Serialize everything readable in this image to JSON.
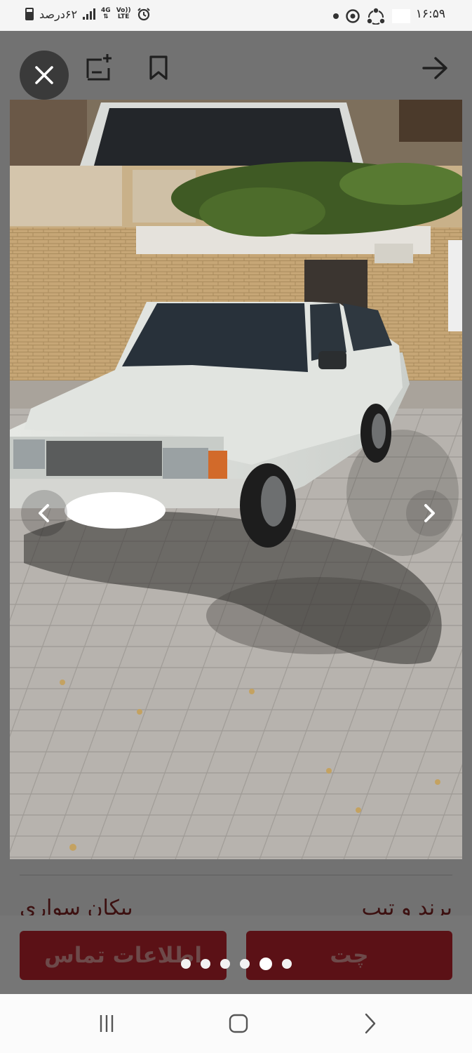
{
  "status_bar": {
    "time": "۱۶:۵۹",
    "battery_text": "۶۲درصد",
    "network_top": "4G",
    "volte_top": "Vo))",
    "volte_bottom": "LTE"
  },
  "toolbar": {
    "close_icon": "close-icon",
    "add_note_icon": "add-note-icon",
    "bookmark_icon": "bookmark-icon",
    "back_icon": "arrow-right-icon"
  },
  "gallery": {
    "image_alt": "",
    "dots_count": 6,
    "active_index": 4
  },
  "listing": {
    "title_right": "برند و تیپ",
    "title_left": "پیکان سواری"
  },
  "actions": {
    "contact_label": "اطلاعات تماس",
    "chat_label": "چت"
  },
  "colors": {
    "accent": "#5b1116",
    "overlay": "#727272"
  }
}
